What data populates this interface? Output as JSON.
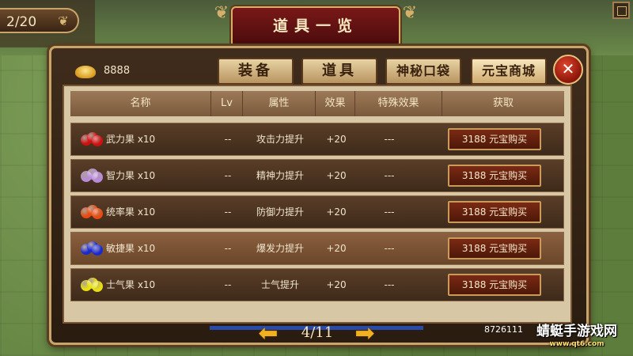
{
  "hud": {
    "page_counter": "2/20",
    "id_text": "8726111"
  },
  "window": {
    "title": "道具一览",
    "gold_amount": "8888",
    "tabs": [
      {
        "label": "装备"
      },
      {
        "label": "道具"
      },
      {
        "label": "神秘口袋"
      },
      {
        "label": "元宝商城",
        "selected": true
      }
    ],
    "close_label": "✕"
  },
  "table": {
    "headers": [
      "名称",
      "Lv",
      "属性",
      "效果",
      "特殊效果",
      "获取"
    ],
    "rows": [
      {
        "name": "武力果 x10",
        "lv": "--",
        "attr": "攻击力提升",
        "effect": "+20",
        "special": "---",
        "buy": "3188 元宝购买",
        "fruit_color": "#d01010"
      },
      {
        "name": "智力果 x10",
        "lv": "--",
        "attr": "精神力提升",
        "effect": "+20",
        "special": "---",
        "buy": "3188 元宝购买",
        "fruit_color": "#b88ad8"
      },
      {
        "name": "统率果 x10",
        "lv": "--",
        "attr": "防御力提升",
        "effect": "+20",
        "special": "---",
        "buy": "3188 元宝购买",
        "fruit_color": "#e84a10"
      },
      {
        "name": "敏捷果 x10",
        "lv": "--",
        "attr": "爆发力提升",
        "effect": "+20",
        "special": "---",
        "buy": "3188 元宝购买",
        "fruit_color": "#1a2ad0"
      },
      {
        "name": "士气果 x10",
        "lv": "--",
        "attr": "士气提升",
        "effect": "+20",
        "special": "---",
        "buy": "3188 元宝购买",
        "fruit_color": "#e8e010"
      }
    ]
  },
  "pager": {
    "page_text": "4/11",
    "prev_icon": "arrow-left-icon",
    "next_icon": "arrow-right-icon"
  },
  "watermark": {
    "main": "蜻蜓手游戏网",
    "sub": "www.qt6.com"
  }
}
